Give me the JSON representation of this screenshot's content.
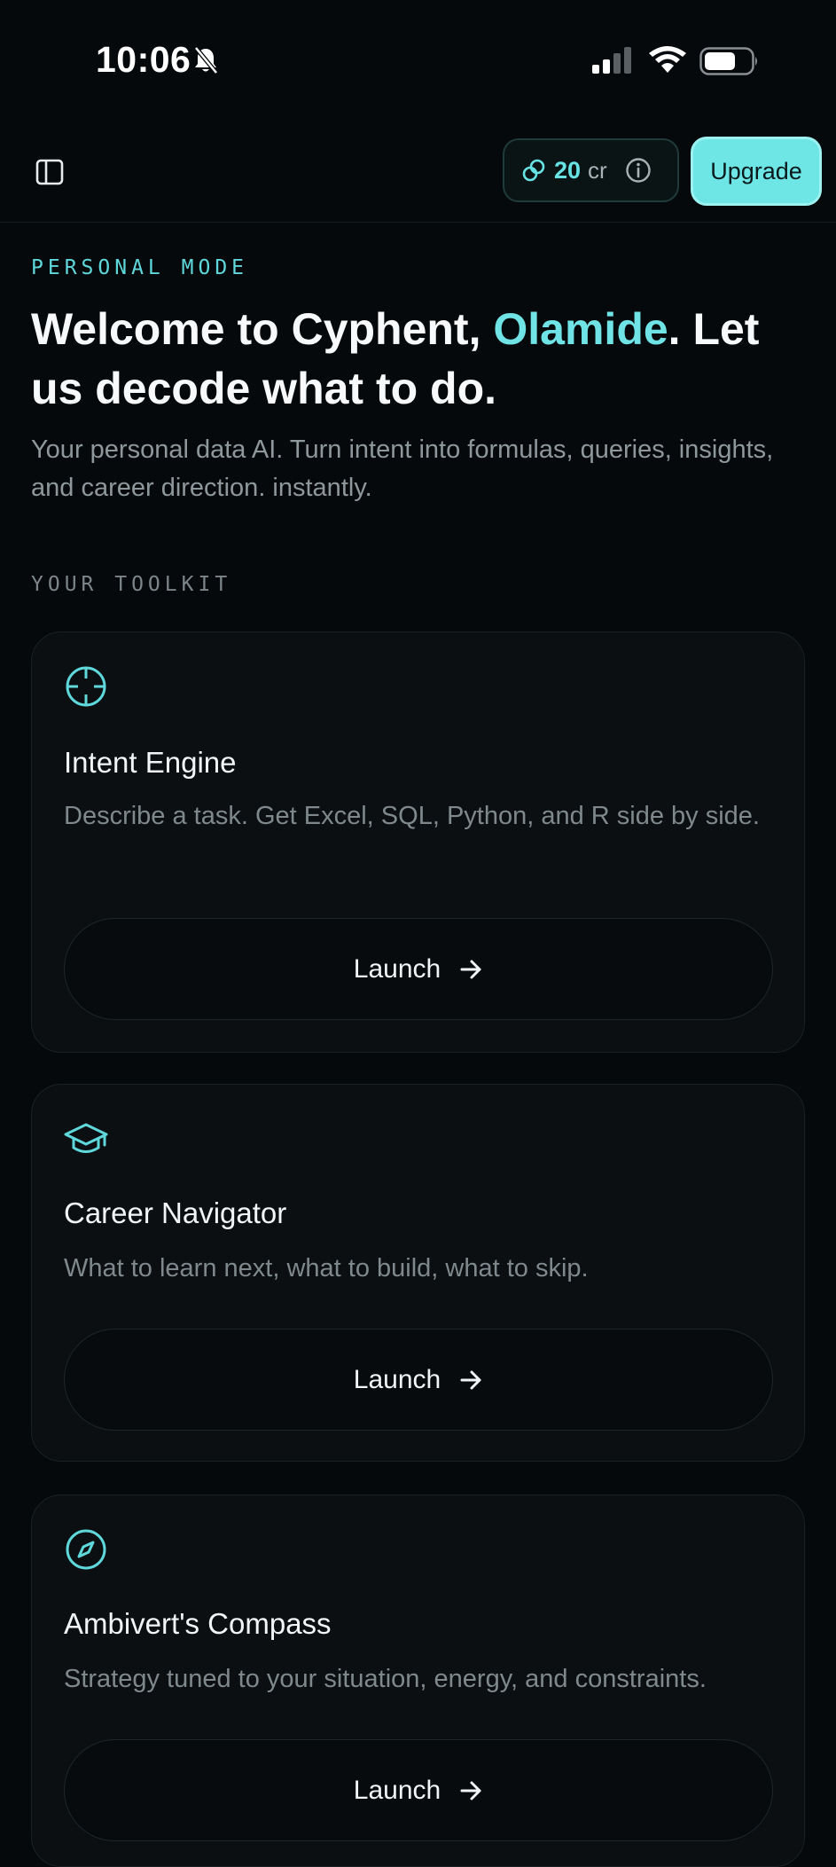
{
  "status_bar": {
    "time": "10:06",
    "icons": [
      "bell-off-icon",
      "signal-icon",
      "wifi-icon",
      "battery-icon"
    ]
  },
  "header": {
    "credits_count": "20",
    "credits_unit": "cr",
    "upgrade_label": "Upgrade",
    "icons": [
      "sidebar-toggle-icon",
      "link-icon",
      "info-icon"
    ]
  },
  "hero": {
    "eyebrow": "PERSONAL MODE",
    "headline_prefix": "Welcome to Cyphent, ",
    "user_name": "Olamide",
    "headline_suffix": ". Let us decode what to do.",
    "subtitle": "Your personal data AI. Turn intent into formulas, queries, insights, and career direction. instantly."
  },
  "toolkit": {
    "label": "YOUR TOOLKIT",
    "tools": [
      {
        "icon": "crosshair-icon",
        "title": "Intent Engine",
        "description": "Describe a task. Get Excel, SQL, Python, and R side by side.",
        "button_label": "Launch"
      },
      {
        "icon": "graduation-cap-icon",
        "title": "Career Navigator",
        "description": "What to learn next, what to build, what to skip.",
        "button_label": "Launch"
      },
      {
        "icon": "compass-icon",
        "title": "Ambivert's Compass",
        "description": "Strategy tuned to your situation, energy, and constraints.",
        "button_label": "Launch"
      }
    ]
  },
  "colors": {
    "background": "#06090b",
    "accent": "#6fe3e5",
    "card": "#0b0f11",
    "upgrade_button": "#6fe6e6"
  }
}
